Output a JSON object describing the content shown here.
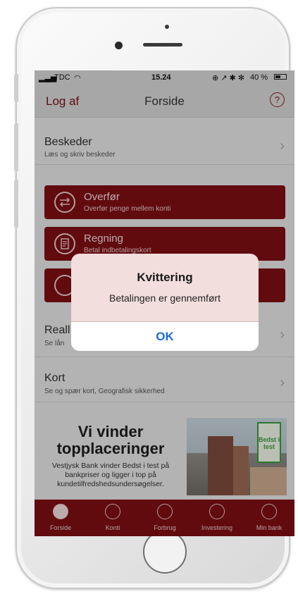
{
  "status_bar": {
    "carrier": "TDC",
    "time": "15.24",
    "battery": "40 %"
  },
  "nav": {
    "left_label": "Log af",
    "title": "Forside",
    "help_symbol": "?"
  },
  "rows": {
    "beskeder": {
      "title": "Beskeder",
      "subtitle": "Læs og skriv beskeder"
    },
    "real": {
      "title": "Reall",
      "subtitle": "Se lån"
    },
    "kort": {
      "title": "Kort",
      "subtitle": "Se og spær kort, Geografisk sikkerhed"
    }
  },
  "actions": [
    {
      "title": "Overfør",
      "subtitle": "Overfør penge mellem konti",
      "icon": "arrows-swap-icon"
    },
    {
      "title": "Regning",
      "subtitle": "Betal indbetalingskort",
      "icon": "invoice-icon"
    },
    {
      "title": "",
      "subtitle": "",
      "icon": "wallet-icon"
    }
  ],
  "promo": {
    "headline": "Vi vinder topplaceringer",
    "body": "Vestjysk Bank vinder Bedst i test på bankpriser og ligger i top på kundetilfredshedsundersøgelser.",
    "badge_text": "Bedst i test"
  },
  "tabs": [
    {
      "label": "Forside",
      "icon": "home-icon",
      "active": true
    },
    {
      "label": "Konti",
      "icon": "wallet-icon",
      "active": false
    },
    {
      "label": "Forbrug",
      "icon": "bar-chart-icon",
      "active": false
    },
    {
      "label": "Investering",
      "icon": "trend-icon",
      "active": false
    },
    {
      "label": "Min bank",
      "icon": "user-icon",
      "active": false
    }
  ],
  "alert": {
    "title": "Kvittering",
    "message": "Betalingen er gennemført",
    "button": "OK"
  },
  "colors": {
    "brand": "#7d0f14",
    "alert_button": "#1a6ad6"
  }
}
